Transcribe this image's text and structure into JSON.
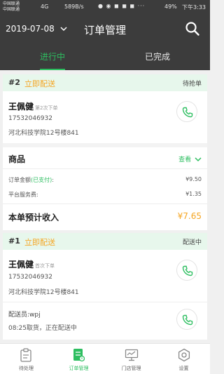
{
  "status_bar": {
    "carrier1": "中国联通",
    "carrier2": "中国联通",
    "network": "4G",
    "speed": "589B/s",
    "battery": "49%",
    "time": "下午3:33"
  },
  "header": {
    "date": "2019-07-08",
    "title": "订单管理",
    "tabs": [
      {
        "label": "进行中",
        "active": true
      },
      {
        "label": "已完成",
        "active": false
      }
    ]
  },
  "orders": [
    {
      "number": "#2",
      "delivery": "立即配送",
      "status": "待抢单",
      "customer": {
        "name": "王佩健",
        "note": "第2次下单",
        "phone": "17532046932",
        "address": "河北科技学院12号楼841"
      },
      "goods_label": "商品",
      "view_label": "查看",
      "amount_label": "订单金额",
      "paid_label": "(已支付)",
      "amount_suffix": ":",
      "amount": "¥9.50",
      "fee_label": "平台服务费:",
      "fee": "¥1.35",
      "income_label": "本单预计收入",
      "income": "¥7.65"
    },
    {
      "number": "#1",
      "delivery": "立即配送",
      "status": "配送中",
      "customer": {
        "name": "王佩健",
        "note": "首次下单",
        "phone": "17532046932",
        "address": "河北科技学院12号楼841"
      },
      "courier": "配送员:wpj",
      "courier_status": "08:25取货，正在配送中"
    }
  ],
  "nav": [
    {
      "label": "待处理",
      "icon": "clipboard-icon",
      "active": false
    },
    {
      "label": "订单管理",
      "icon": "order-doc-icon",
      "active": true
    },
    {
      "label": "门店管理",
      "icon": "monitor-icon",
      "active": false
    },
    {
      "label": "设置",
      "icon": "gear-icon",
      "active": false
    }
  ],
  "colors": {
    "accent": "#2dbe60",
    "orange": "#f5a623",
    "header_bg": "#3c3c3c"
  }
}
